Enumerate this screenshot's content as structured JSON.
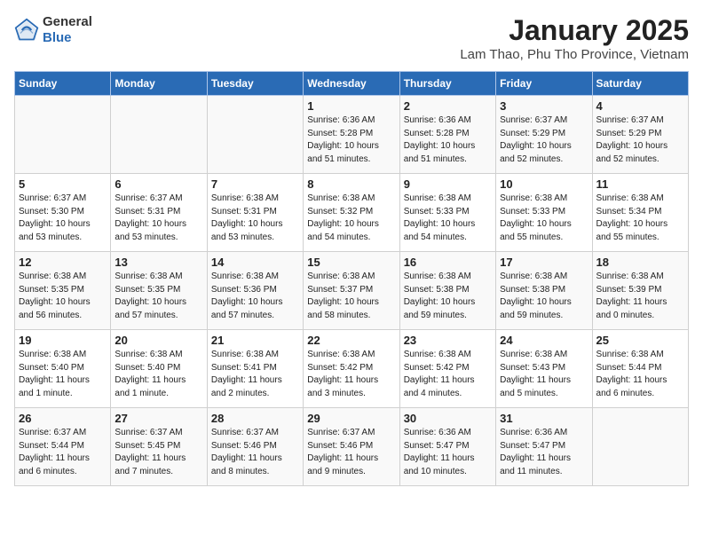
{
  "logo": {
    "general": "General",
    "blue": "Blue"
  },
  "title": "January 2025",
  "subtitle": "Lam Thao, Phu Tho Province, Vietnam",
  "headers": [
    "Sunday",
    "Monday",
    "Tuesday",
    "Wednesday",
    "Thursday",
    "Friday",
    "Saturday"
  ],
  "weeks": [
    [
      {
        "day": "",
        "text": ""
      },
      {
        "day": "",
        "text": ""
      },
      {
        "day": "",
        "text": ""
      },
      {
        "day": "1",
        "text": "Sunrise: 6:36 AM\nSunset: 5:28 PM\nDaylight: 10 hours\nand 51 minutes."
      },
      {
        "day": "2",
        "text": "Sunrise: 6:36 AM\nSunset: 5:28 PM\nDaylight: 10 hours\nand 51 minutes."
      },
      {
        "day": "3",
        "text": "Sunrise: 6:37 AM\nSunset: 5:29 PM\nDaylight: 10 hours\nand 52 minutes."
      },
      {
        "day": "4",
        "text": "Sunrise: 6:37 AM\nSunset: 5:29 PM\nDaylight: 10 hours\nand 52 minutes."
      }
    ],
    [
      {
        "day": "5",
        "text": "Sunrise: 6:37 AM\nSunset: 5:30 PM\nDaylight: 10 hours\nand 53 minutes."
      },
      {
        "day": "6",
        "text": "Sunrise: 6:37 AM\nSunset: 5:31 PM\nDaylight: 10 hours\nand 53 minutes."
      },
      {
        "day": "7",
        "text": "Sunrise: 6:38 AM\nSunset: 5:31 PM\nDaylight: 10 hours\nand 53 minutes."
      },
      {
        "day": "8",
        "text": "Sunrise: 6:38 AM\nSunset: 5:32 PM\nDaylight: 10 hours\nand 54 minutes."
      },
      {
        "day": "9",
        "text": "Sunrise: 6:38 AM\nSunset: 5:33 PM\nDaylight: 10 hours\nand 54 minutes."
      },
      {
        "day": "10",
        "text": "Sunrise: 6:38 AM\nSunset: 5:33 PM\nDaylight: 10 hours\nand 55 minutes."
      },
      {
        "day": "11",
        "text": "Sunrise: 6:38 AM\nSunset: 5:34 PM\nDaylight: 10 hours\nand 55 minutes."
      }
    ],
    [
      {
        "day": "12",
        "text": "Sunrise: 6:38 AM\nSunset: 5:35 PM\nDaylight: 10 hours\nand 56 minutes."
      },
      {
        "day": "13",
        "text": "Sunrise: 6:38 AM\nSunset: 5:35 PM\nDaylight: 10 hours\nand 57 minutes."
      },
      {
        "day": "14",
        "text": "Sunrise: 6:38 AM\nSunset: 5:36 PM\nDaylight: 10 hours\nand 57 minutes."
      },
      {
        "day": "15",
        "text": "Sunrise: 6:38 AM\nSunset: 5:37 PM\nDaylight: 10 hours\nand 58 minutes."
      },
      {
        "day": "16",
        "text": "Sunrise: 6:38 AM\nSunset: 5:38 PM\nDaylight: 10 hours\nand 59 minutes."
      },
      {
        "day": "17",
        "text": "Sunrise: 6:38 AM\nSunset: 5:38 PM\nDaylight: 10 hours\nand 59 minutes."
      },
      {
        "day": "18",
        "text": "Sunrise: 6:38 AM\nSunset: 5:39 PM\nDaylight: 11 hours\nand 0 minutes."
      }
    ],
    [
      {
        "day": "19",
        "text": "Sunrise: 6:38 AM\nSunset: 5:40 PM\nDaylight: 11 hours\nand 1 minute."
      },
      {
        "day": "20",
        "text": "Sunrise: 6:38 AM\nSunset: 5:40 PM\nDaylight: 11 hours\nand 1 minute."
      },
      {
        "day": "21",
        "text": "Sunrise: 6:38 AM\nSunset: 5:41 PM\nDaylight: 11 hours\nand 2 minutes."
      },
      {
        "day": "22",
        "text": "Sunrise: 6:38 AM\nSunset: 5:42 PM\nDaylight: 11 hours\nand 3 minutes."
      },
      {
        "day": "23",
        "text": "Sunrise: 6:38 AM\nSunset: 5:42 PM\nDaylight: 11 hours\nand 4 minutes."
      },
      {
        "day": "24",
        "text": "Sunrise: 6:38 AM\nSunset: 5:43 PM\nDaylight: 11 hours\nand 5 minutes."
      },
      {
        "day": "25",
        "text": "Sunrise: 6:38 AM\nSunset: 5:44 PM\nDaylight: 11 hours\nand 6 minutes."
      }
    ],
    [
      {
        "day": "26",
        "text": "Sunrise: 6:37 AM\nSunset: 5:44 PM\nDaylight: 11 hours\nand 6 minutes."
      },
      {
        "day": "27",
        "text": "Sunrise: 6:37 AM\nSunset: 5:45 PM\nDaylight: 11 hours\nand 7 minutes."
      },
      {
        "day": "28",
        "text": "Sunrise: 6:37 AM\nSunset: 5:46 PM\nDaylight: 11 hours\nand 8 minutes."
      },
      {
        "day": "29",
        "text": "Sunrise: 6:37 AM\nSunset: 5:46 PM\nDaylight: 11 hours\nand 9 minutes."
      },
      {
        "day": "30",
        "text": "Sunrise: 6:36 AM\nSunset: 5:47 PM\nDaylight: 11 hours\nand 10 minutes."
      },
      {
        "day": "31",
        "text": "Sunrise: 6:36 AM\nSunset: 5:47 PM\nDaylight: 11 hours\nand 11 minutes."
      },
      {
        "day": "",
        "text": ""
      }
    ]
  ]
}
